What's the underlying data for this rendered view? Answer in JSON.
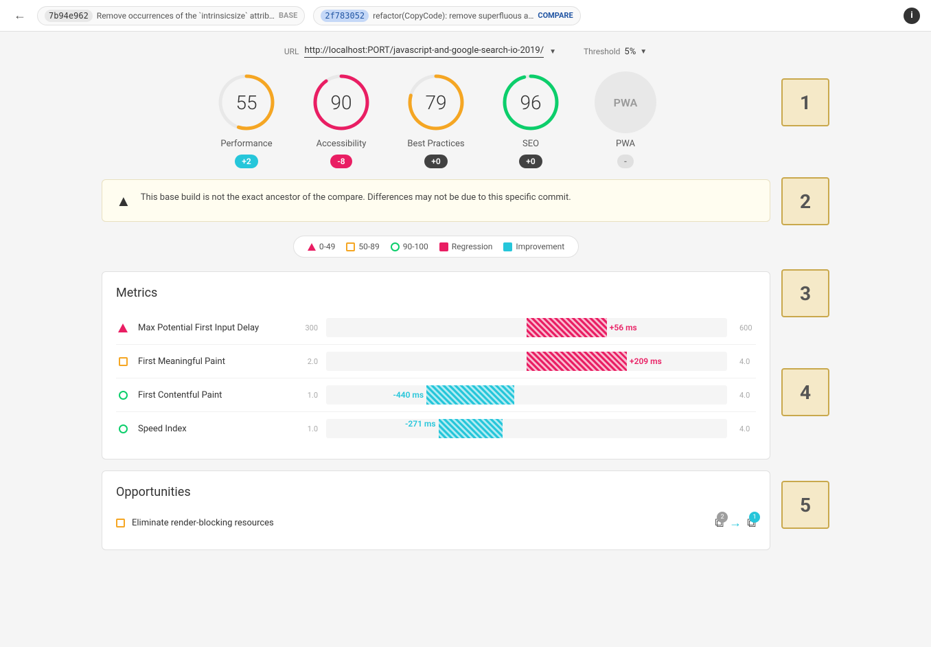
{
  "topbar": {
    "back_button": "←",
    "base_hash": "7b94e962",
    "base_msg": "Remove occurrences of the `intrinsicsize` attrib…",
    "base_label": "BASE",
    "compare_hash": "2f783052",
    "compare_msg": "refactor(CopyCode): remove superfluous a…",
    "compare_label": "COMPARE",
    "info_icon": "i"
  },
  "url_bar": {
    "url_label": "URL",
    "url_value": "http://localhost:PORT/javascript-and-google-search-io-2019/",
    "threshold_label": "Threshold",
    "threshold_value": "5%"
  },
  "scores": [
    {
      "id": "performance",
      "value": "55",
      "label": "Performance",
      "badge": "+2",
      "badge_type": "blue",
      "ring_color": "#f5a623",
      "ring_pct": 55
    },
    {
      "id": "accessibility",
      "value": "90",
      "label": "Accessibility",
      "badge": "-8",
      "badge_type": "red",
      "ring_color": "#e91e63",
      "ring_pct": 90
    },
    {
      "id": "best-practices",
      "value": "79",
      "label": "Best Practices",
      "badge": "+0",
      "badge_type": "dark",
      "ring_color": "#f5a623",
      "ring_pct": 79
    },
    {
      "id": "seo",
      "value": "96",
      "label": "SEO",
      "badge": "+0",
      "badge_type": "dark",
      "ring_color": "#0cce6b",
      "ring_pct": 96
    },
    {
      "id": "pwa",
      "value": "PWA",
      "label": "PWA",
      "badge": "-",
      "badge_type": "gray"
    }
  ],
  "warning": {
    "icon": "▲",
    "text": "This base build is not the exact ancestor of the compare. Differences may not be due to this specific commit."
  },
  "legend": {
    "items": [
      {
        "id": "range-0-49",
        "icon_type": "triangle-red",
        "label": "0-49"
      },
      {
        "id": "range-50-89",
        "icon_type": "square-orange",
        "label": "50-89"
      },
      {
        "id": "range-90-100",
        "icon_type": "circle-green",
        "label": "90-100"
      },
      {
        "id": "regression",
        "icon_type": "rect-red",
        "label": "Regression"
      },
      {
        "id": "improvement",
        "icon_type": "rect-teal",
        "label": "Improvement"
      }
    ]
  },
  "metrics": {
    "title": "Metrics",
    "rows": [
      {
        "id": "max-potential-fid",
        "icon_type": "triangle-red",
        "name": "Max Potential First Input Delay",
        "scale_start": "300",
        "scale_end": "600",
        "bar_type": "regression",
        "bar_offset_pct": 50,
        "bar_width_pct": 20,
        "bar_label": "+56 ms"
      },
      {
        "id": "first-meaningful-paint",
        "icon_type": "square-orange",
        "name": "First Meaningful Paint",
        "scale_start": "2.0",
        "scale_end": "4.0",
        "bar_type": "regression",
        "bar_offset_pct": 50,
        "bar_width_pct": 25,
        "bar_label": "+209 ms"
      },
      {
        "id": "first-contentful-paint",
        "icon_type": "circle-green",
        "name": "First Contentful Paint",
        "scale_start": "1.0",
        "scale_end": "4.0",
        "bar_type": "improvement",
        "bar_offset_pct": 25,
        "bar_width_pct": 22,
        "bar_label": "-440 ms"
      },
      {
        "id": "speed-index",
        "icon_type": "circle-green",
        "name": "Speed Index",
        "scale_start": "1.0",
        "scale_end": "4.0",
        "bar_type": "improvement",
        "bar_offset_pct": 28,
        "bar_width_pct": 16,
        "bar_label": "-271 ms"
      }
    ]
  },
  "opportunities": {
    "title": "Opportunities",
    "rows": [
      {
        "id": "eliminate-render-blocking",
        "icon_type": "square-orange",
        "name": "Eliminate render-blocking resources",
        "base_count": "2",
        "compare_count": "1"
      }
    ]
  },
  "annotations": {
    "boxes": [
      "1",
      "2",
      "3",
      "4",
      "5"
    ]
  }
}
